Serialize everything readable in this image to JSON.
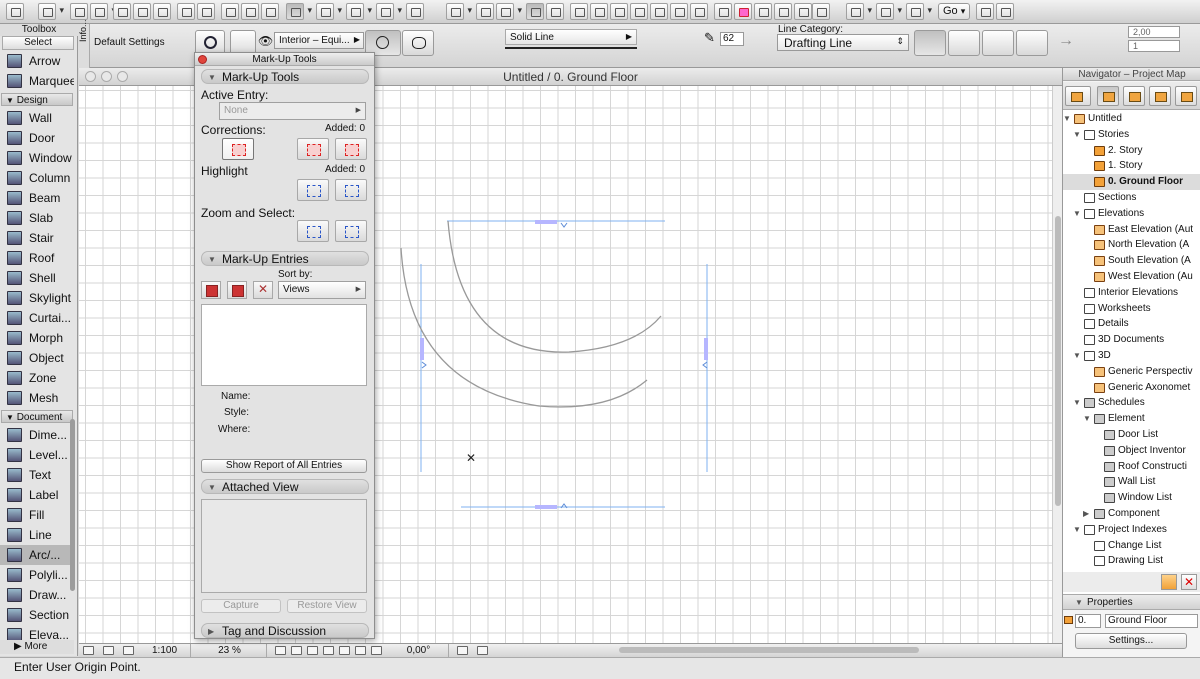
{
  "toolbar": {
    "go_label": "Go"
  },
  "infobox": {
    "info_label": "Info...",
    "default_settings": "Default Settings",
    "layer_value": "Interior – Equi...",
    "line_type": "Solid Line",
    "pen_number": "62",
    "line_category_label": "Line Category:",
    "line_category_value": "Drafting Line",
    "angle_value": "2,00",
    "count_value": "1"
  },
  "toolbox": {
    "title": "Toolbox",
    "select_label": "Select",
    "categories": {
      "design": "Design",
      "document": "Document"
    },
    "select_tools": [
      {
        "label": "Arrow",
        "icon": "arrow-icon"
      },
      {
        "label": "Marquee",
        "icon": "marquee-icon"
      }
    ],
    "design_tools": [
      {
        "label": "Wall",
        "icon": "wall-icon"
      },
      {
        "label": "Door",
        "icon": "door-icon"
      },
      {
        "label": "Window",
        "icon": "window-icon"
      },
      {
        "label": "Column",
        "icon": "column-icon"
      },
      {
        "label": "Beam",
        "icon": "beam-icon"
      },
      {
        "label": "Slab",
        "icon": "slab-icon"
      },
      {
        "label": "Stair",
        "icon": "stair-icon"
      },
      {
        "label": "Roof",
        "icon": "roof-icon"
      },
      {
        "label": "Shell",
        "icon": "shell-icon"
      },
      {
        "label": "Skylight",
        "icon": "skylight-icon"
      },
      {
        "label": "Curtai...",
        "icon": "curtain-wall-icon"
      },
      {
        "label": "Morph",
        "icon": "morph-icon"
      },
      {
        "label": "Object",
        "icon": "object-icon"
      },
      {
        "label": "Zone",
        "icon": "zone-icon"
      },
      {
        "label": "Mesh",
        "icon": "mesh-icon"
      }
    ],
    "document_tools": [
      {
        "label": "Dime...",
        "icon": "dimension-icon"
      },
      {
        "label": "Level...",
        "icon": "level-dimension-icon"
      },
      {
        "label": "Text",
        "icon": "text-icon"
      },
      {
        "label": "Label",
        "icon": "label-icon"
      },
      {
        "label": "Fill",
        "icon": "fill-icon"
      },
      {
        "label": "Line",
        "icon": "line-icon"
      },
      {
        "label": "Arc/...",
        "icon": "arc-icon",
        "selected": true
      },
      {
        "label": "Polyli...",
        "icon": "polyline-icon"
      },
      {
        "label": "Draw...",
        "icon": "drawing-icon"
      },
      {
        "label": "Section",
        "icon": "section-icon"
      },
      {
        "label": "Eleva...",
        "icon": "elevation-icon"
      }
    ],
    "more_label": "More"
  },
  "plan_window": {
    "title": "Untitled / 0. Ground Floor"
  },
  "bottom_bar": {
    "scale": "1:100",
    "zoom": "23 %",
    "angle": "0,00°"
  },
  "status_bar": {
    "message": "Enter User Origin Point."
  },
  "markup_palette": {
    "title": "Mark-Up Tools",
    "section_tools": "Mark-Up Tools",
    "active_entry_label": "Active Entry:",
    "active_entry_value": "None",
    "corrections_label": "Corrections:",
    "corrections_added": "Added: 0",
    "highlight_label": "Highlight",
    "highlight_added": "Added: 0",
    "zoom_select_label": "Zoom and Select:",
    "section_entries": "Mark-Up Entries",
    "sort_by_label": "Sort by:",
    "sort_by_value": "Views",
    "name_label": "Name:",
    "style_label": "Style:",
    "where_label": "Where:",
    "show_report_button": "Show Report of All Entries",
    "section_attached": "Attached View",
    "capture_button": "Capture",
    "restore_view_button": "Restore View",
    "section_tag": "Tag and Discussion"
  },
  "navigator": {
    "title": "Navigator – Project Map",
    "tree": [
      {
        "label": "Untitled",
        "level": 0,
        "toggle": "open",
        "icon": "house"
      },
      {
        "label": "Stories",
        "level": 1,
        "toggle": "open",
        "icon": "doc"
      },
      {
        "label": "2. Story",
        "level": 2,
        "toggle": "",
        "icon": "story"
      },
      {
        "label": "1. Story",
        "level": 2,
        "toggle": "",
        "icon": "story"
      },
      {
        "label": "0. Ground Floor",
        "level": 2,
        "toggle": "",
        "icon": "story",
        "selected": true
      },
      {
        "label": "Sections",
        "level": 1,
        "toggle": "",
        "icon": "doc"
      },
      {
        "label": "Elevations",
        "level": 1,
        "toggle": "open",
        "icon": "doc"
      },
      {
        "label": "East Elevation (Aut",
        "level": 2,
        "toggle": "",
        "icon": "house"
      },
      {
        "label": "North Elevation (A",
        "level": 2,
        "toggle": "",
        "icon": "house"
      },
      {
        "label": "South Elevation (A",
        "level": 2,
        "toggle": "",
        "icon": "house"
      },
      {
        "label": "West Elevation (Au",
        "level": 2,
        "toggle": "",
        "icon": "house"
      },
      {
        "label": "Interior Elevations",
        "level": 1,
        "toggle": "",
        "icon": "doc"
      },
      {
        "label": "Worksheets",
        "level": 1,
        "toggle": "",
        "icon": "doc"
      },
      {
        "label": "Details",
        "level": 1,
        "toggle": "",
        "icon": "doc"
      },
      {
        "label": "3D Documents",
        "level": 1,
        "toggle": "",
        "icon": "doc"
      },
      {
        "label": "3D",
        "level": 1,
        "toggle": "open",
        "icon": "doc"
      },
      {
        "label": "Generic Perspectiv",
        "level": 2,
        "toggle": "",
        "icon": "house"
      },
      {
        "label": "Generic Axonomet",
        "level": 2,
        "toggle": "",
        "icon": "house"
      },
      {
        "label": "Schedules",
        "level": 1,
        "toggle": "open",
        "icon": "sched"
      },
      {
        "label": "Element",
        "level": 2,
        "toggle": "open",
        "icon": "sched"
      },
      {
        "label": "Door List",
        "level": 3,
        "toggle": "",
        "icon": "sched"
      },
      {
        "label": "Object Inventor",
        "level": 3,
        "toggle": "",
        "icon": "sched"
      },
      {
        "label": "Roof Constructi",
        "level": 3,
        "toggle": "",
        "icon": "sched"
      },
      {
        "label": "Wall List",
        "level": 3,
        "toggle": "",
        "icon": "sched"
      },
      {
        "label": "Window List",
        "level": 3,
        "toggle": "",
        "icon": "sched"
      },
      {
        "label": "Component",
        "level": 2,
        "toggle": "closed",
        "icon": "sched"
      },
      {
        "label": "Project Indexes",
        "level": 1,
        "toggle": "open",
        "icon": "doc"
      },
      {
        "label": "Change List",
        "level": 2,
        "toggle": "",
        "icon": "doc"
      },
      {
        "label": "Drawing List",
        "level": 2,
        "toggle": "",
        "icon": "doc"
      }
    ],
    "properties_label": "Properties",
    "prop_number": "0.",
    "prop_name": "Ground Floor",
    "settings_button": "Settings..."
  }
}
